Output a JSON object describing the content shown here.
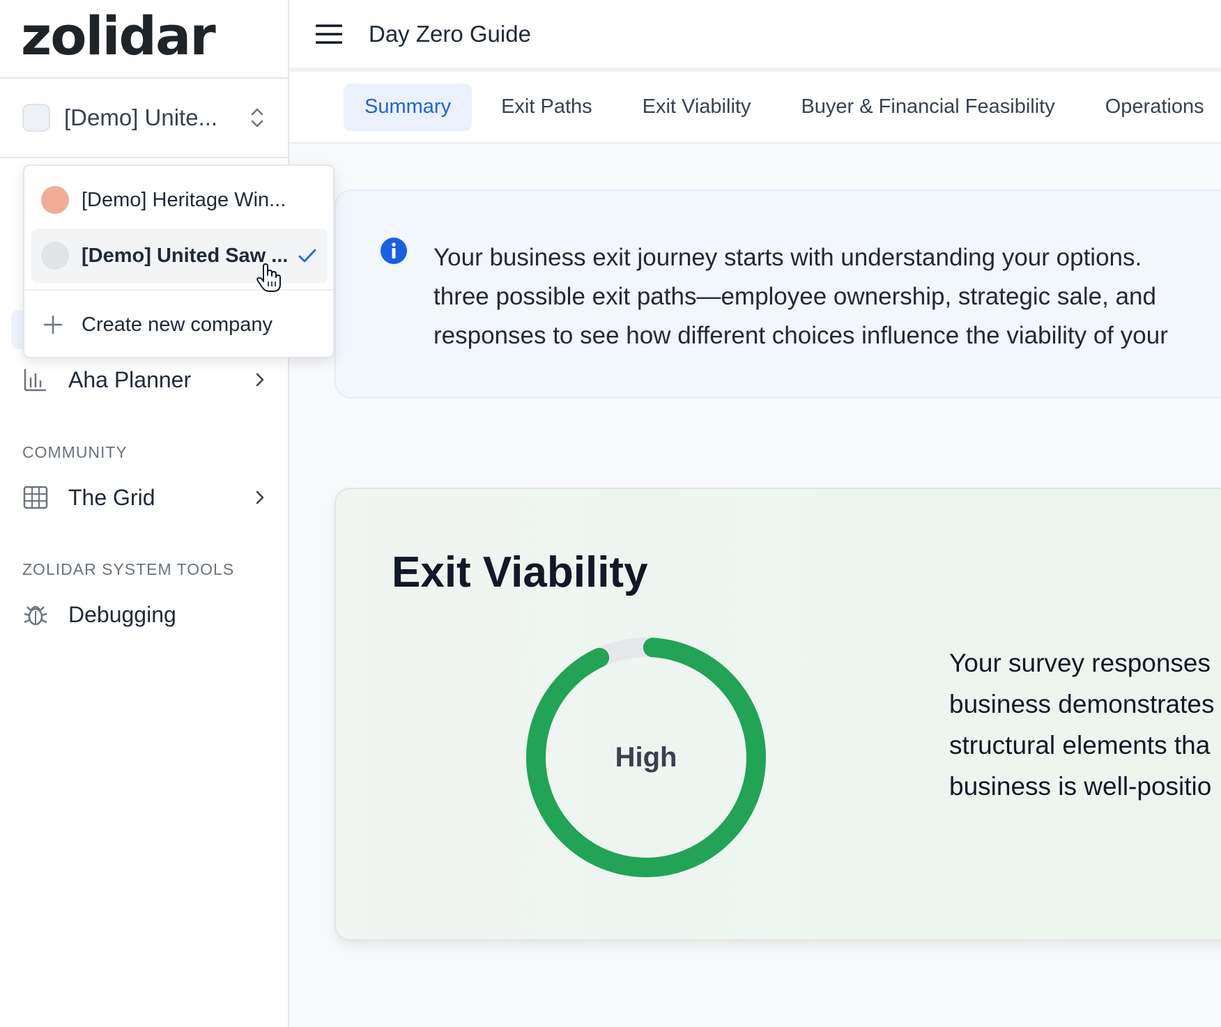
{
  "sidebar": {
    "logo": "zolidar",
    "company_switcher": {
      "label": "[Demo] Unite..."
    },
    "nav": [
      {
        "label": "Aha Planner"
      }
    ],
    "sections": [
      {
        "title": "COMMUNITY",
        "items": [
          {
            "label": "The Grid"
          }
        ]
      },
      {
        "title": "ZOLIDAR SYSTEM TOOLS",
        "items": [
          {
            "label": "Debugging"
          }
        ]
      }
    ]
  },
  "company_dropdown": {
    "items": [
      {
        "label": "[Demo] Heritage Win...",
        "color": "#f1ae97",
        "selected": false
      },
      {
        "label": "[Demo] United Saw ...",
        "color": "#e2e3e6",
        "selected": true
      }
    ],
    "create_label": "Create new company",
    "check_color": "#2563eb"
  },
  "header": {
    "title": "Day Zero Guide"
  },
  "tabs": [
    {
      "label": "Summary",
      "active": true
    },
    {
      "label": "Exit Paths",
      "active": false
    },
    {
      "label": "Exit Viability",
      "active": false
    },
    {
      "label": "Buyer & Financial Feasibility",
      "active": false
    },
    {
      "label": "Operations",
      "active": false
    }
  ],
  "info": {
    "lines": [
      "Your business exit journey starts with understanding your options.",
      "three possible exit paths—employee ownership, strategic sale, and",
      "responses to see how different choices influence the viability of your"
    ]
  },
  "exit_viability": {
    "title": "Exit Viability",
    "rating": "High",
    "score_fraction": 0.92,
    "gauge_color": "#22a355",
    "track_color": "#e5e7eb",
    "text_lines": [
      "Your survey responses",
      "business demonstrates",
      "structural elements tha",
      "business is well-positio"
    ]
  },
  "colors": {
    "accent": "#1e63d6",
    "info_icon": "#1a5fe0"
  }
}
